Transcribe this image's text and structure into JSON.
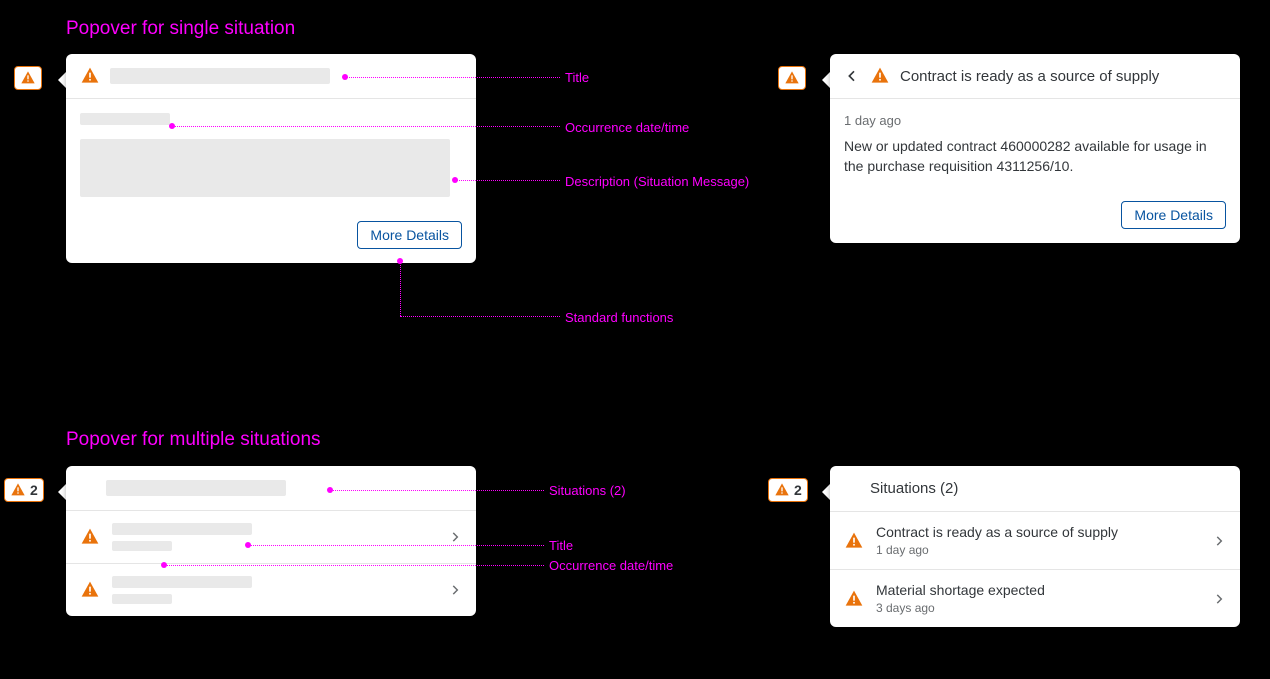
{
  "sections": {
    "single": "Popover for single situation",
    "multiple": "Popover for multiple situations"
  },
  "annotations": {
    "title": "Title",
    "occurrence": "Occurrence date/time",
    "description": "Description (Situation Message)",
    "standard_functions": "Standard functions",
    "situations_count": "Situations (2)"
  },
  "buttons": {
    "more_details": "More Details"
  },
  "single_example": {
    "title": "Contract is ready as a source of supply",
    "time": "1 day ago",
    "description": "New or updated contract 460000282 available for usage in the purchase requisition 4311256/10."
  },
  "multi_badge_count": "2",
  "multi_header": "Situations (2)",
  "multi_items": [
    {
      "title": "Contract is ready as a source of supply",
      "time": "1 day ago"
    },
    {
      "title": "Material shortage expected",
      "time": "3 days ago"
    }
  ]
}
